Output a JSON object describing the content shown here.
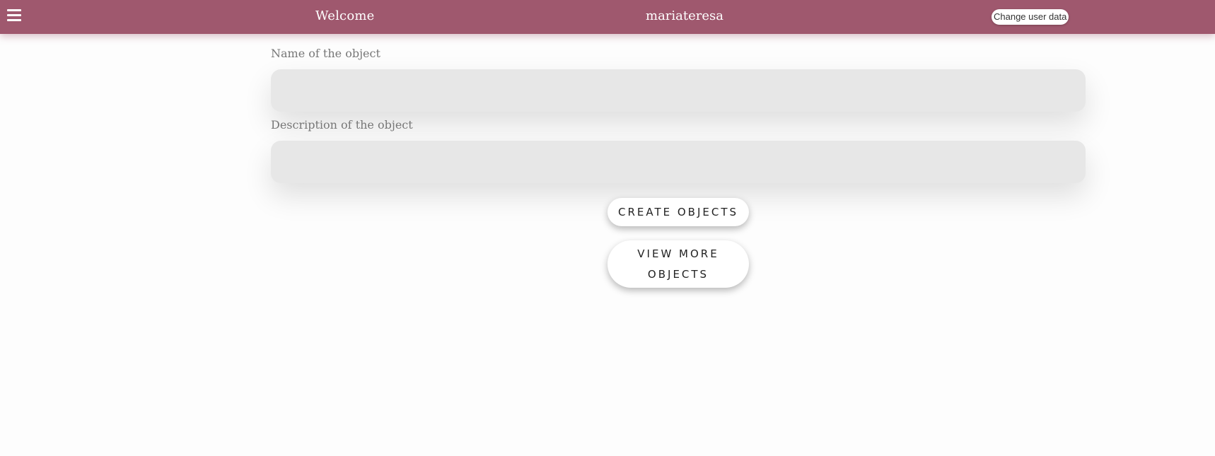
{
  "header": {
    "welcome": "Welcome",
    "username": "mariateresa",
    "change_user_label": "Change user data",
    "menu_icon": "hamburger-menu-icon"
  },
  "form": {
    "name_label": "Name of the object",
    "name_value": "",
    "description_label": "Description of the object",
    "description_value": "",
    "create_label": "CREATE OBJECTS",
    "view_more_label": "VIEW MORE OBJECTS"
  },
  "colors": {
    "header_bg": "#9f586e",
    "page_bg": "#fdfdfd",
    "input_bg": "#e7e7e7"
  }
}
